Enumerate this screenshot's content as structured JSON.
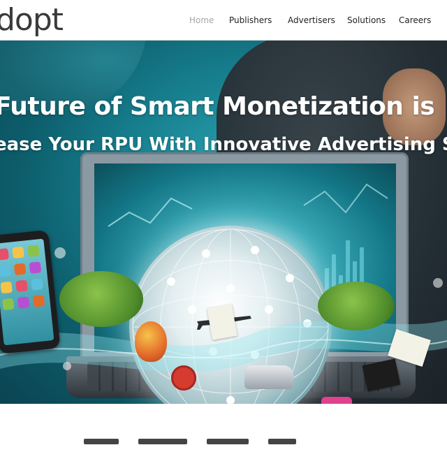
{
  "brand": {
    "logo_text": "dopt"
  },
  "nav": {
    "items": [
      {
        "label": "Home",
        "active": true
      },
      {
        "label": "Publishers",
        "active": false
      },
      {
        "label": "Advertisers",
        "active": false
      },
      {
        "label": "Solutions",
        "active": false
      },
      {
        "label": "Careers",
        "active": false
      }
    ]
  },
  "hero": {
    "title": "Future of Smart Monetization is",
    "subtitle": "ease Your RPU With Innovative Advertising Solutio"
  },
  "colors": {
    "nav_active": "#a5a5a5",
    "nav_text": "#222222",
    "hero_teal": "#17808f",
    "hero_text": "#ffffff"
  }
}
